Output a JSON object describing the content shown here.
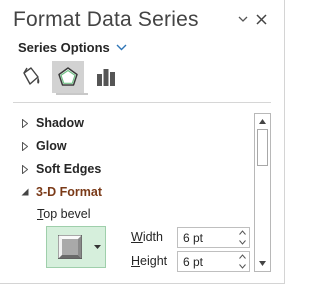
{
  "pane": {
    "title": "Format Data Series",
    "series_options_label": "Series Options",
    "tabs": [
      {
        "name": "Fill & Line",
        "icon": "paint-bucket-icon"
      },
      {
        "name": "Effects",
        "icon": "pentagon-icon"
      },
      {
        "name": "Series Options",
        "icon": "bar-chart-icon"
      }
    ],
    "active_tab": "Effects"
  },
  "sections": [
    {
      "label": "Shadow",
      "expanded": false
    },
    {
      "label": "Glow",
      "expanded": false
    },
    {
      "label": "Soft Edges",
      "expanded": false
    },
    {
      "label": "3-D Format",
      "expanded": true
    }
  ],
  "three_d": {
    "top_bevel_label": "Top bevel",
    "top_bevel_accel": "T",
    "top_bevel_rest": "op bevel",
    "width_label": "Width",
    "width_accel": "W",
    "width_rest": "idth",
    "width_value": "6 pt",
    "height_label": "Height",
    "height_accel": "H",
    "height_rest": "eight",
    "height_value": "6 pt"
  },
  "colors": {
    "accent_blue": "#2e75b6",
    "section_open": "#7a3a18",
    "bevel_bg": "#d6efdc",
    "active_tab_bg": "#d2d2d2"
  }
}
